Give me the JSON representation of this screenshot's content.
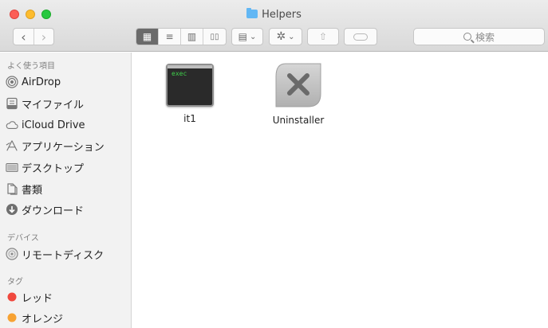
{
  "window": {
    "title": "Helpers"
  },
  "toolbar": {
    "back_label": "‹",
    "forward_label": "›",
    "view_icon_label": "▦",
    "view_list_label": "≡",
    "view_column_label": "▥",
    "view_coverflow_label": "▯▯",
    "arrange_label": "▤",
    "arrange_chevron": "⌄",
    "action_label": "✲",
    "action_chevron": "⌄",
    "share_label": "⇧",
    "tags_label": "◯",
    "search_placeholder": "検索"
  },
  "sidebar": {
    "sections": [
      {
        "heading": "よく使う項目",
        "items": [
          {
            "label": "AirDrop",
            "icon": "airdrop-icon"
          },
          {
            "label": "マイファイル",
            "icon": "all-files-icon"
          },
          {
            "label": "iCloud Drive",
            "icon": "cloud-icon"
          },
          {
            "label": "アプリケーション",
            "icon": "applications-icon"
          },
          {
            "label": "デスクトップ",
            "icon": "desktop-icon"
          },
          {
            "label": "書類",
            "icon": "documents-icon"
          },
          {
            "label": "ダウンロード",
            "icon": "downloads-icon"
          }
        ]
      },
      {
        "heading": "デバイス",
        "items": [
          {
            "label": "リモートディスク",
            "icon": "remote-disc-icon"
          }
        ]
      },
      {
        "heading": "タグ",
        "items": [
          {
            "label": "レッド",
            "icon": "tag-red-icon",
            "color": "#f0483e"
          },
          {
            "label": "オレンジ",
            "icon": "tag-orange-icon",
            "color": "#f7a233"
          }
        ]
      }
    ]
  },
  "files": [
    {
      "name": "it1",
      "icon": "exec-terminal-icon",
      "icon_text": "exec"
    },
    {
      "name": "Uninstaller",
      "icon": "uninstaller-icon"
    }
  ],
  "colors": {
    "folder": "#62b7f4",
    "tag_red": "#f0483e",
    "tag_orange": "#f7a233",
    "exec_text": "#3ecf4a"
  }
}
